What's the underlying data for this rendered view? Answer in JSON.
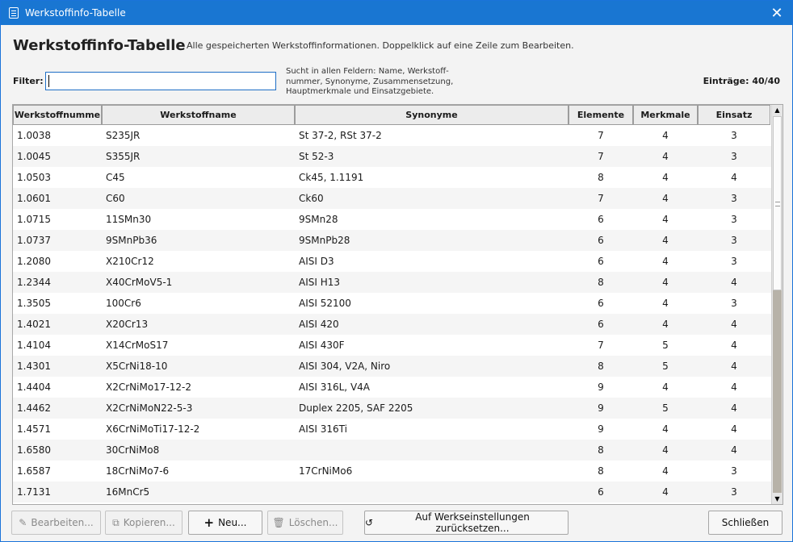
{
  "window": {
    "title": "Werkstoffinfo-Tabelle",
    "close_glyph": "✕"
  },
  "header": {
    "title": "Werkstoffinfo-Tabelle",
    "subtitle": "Alle gespeicherten Werkstoffinformationen. Doppelklick auf eine Zeile zum Bearbeiten."
  },
  "filter": {
    "label": "Filter:",
    "value": "",
    "hint": "Sucht in allen Feldern: Name, Werkstoff-nummer, Synonyme, Zusammensetzung, Hauptmerkmale und Einsatzgebiete.",
    "count": "Einträge: 40/40"
  },
  "table": {
    "columns": [
      "Werkstoffnumme",
      "Werkstoffname",
      "Synonyme",
      "Elemente",
      "Merkmale",
      "Einsatz"
    ],
    "rows": [
      [
        "1.0038",
        "S235JR",
        "St 37-2, RSt 37-2",
        "7",
        "4",
        "3"
      ],
      [
        "1.0045",
        "S355JR",
        "St 52-3",
        "7",
        "4",
        "3"
      ],
      [
        "1.0503",
        "C45",
        "Ck45, 1.1191",
        "8",
        "4",
        "4"
      ],
      [
        "1.0601",
        "C60",
        "Ck60",
        "7",
        "4",
        "3"
      ],
      [
        "1.0715",
        "11SMn30",
        "9SMn28",
        "6",
        "4",
        "3"
      ],
      [
        "1.0737",
        "9SMnPb36",
        "9SMnPb28",
        "6",
        "4",
        "3"
      ],
      [
        "1.2080",
        "X210Cr12",
        "AISI D3",
        "6",
        "4",
        "3"
      ],
      [
        "1.2344",
        "X40CrMoV5-1",
        "AISI H13",
        "8",
        "4",
        "4"
      ],
      [
        "1.3505",
        "100Cr6",
        "AISI 52100",
        "6",
        "4",
        "3"
      ],
      [
        "1.4021",
        "X20Cr13",
        "AISI 420",
        "6",
        "4",
        "4"
      ],
      [
        "1.4104",
        "X14CrMoS17",
        "AISI 430F",
        "7",
        "5",
        "4"
      ],
      [
        "1.4301",
        "X5CrNi18-10",
        "AISI 304, V2A, Niro",
        "8",
        "5",
        "4"
      ],
      [
        "1.4404",
        "X2CrNiMo17-12-2",
        "AISI 316L, V4A",
        "9",
        "4",
        "4"
      ],
      [
        "1.4462",
        "X2CrNiMoN22-5-3",
        "Duplex 2205, SAF 2205",
        "9",
        "5",
        "4"
      ],
      [
        "1.4571",
        "X6CrNiMoTi17-12-2",
        "AISI 316Ti",
        "9",
        "4",
        "4"
      ],
      [
        "1.6580",
        "30CrNiMo8",
        "",
        "8",
        "4",
        "4"
      ],
      [
        "1.6587",
        "18CrNiMo7-6",
        "17CrNiMo6",
        "8",
        "4",
        "3"
      ],
      [
        "1.7131",
        "16MnCr5",
        "",
        "6",
        "4",
        "3"
      ]
    ]
  },
  "buttons": {
    "edit": "Bearbeiten...",
    "copy": "Kopieren...",
    "new": "Neu...",
    "delete": "Löschen...",
    "reset": "Auf Werkseinstellungen zurücksetzen...",
    "close": "Schließen"
  },
  "colors": {
    "titlebar": "#1976d2",
    "focus": "#1f6fc6"
  }
}
